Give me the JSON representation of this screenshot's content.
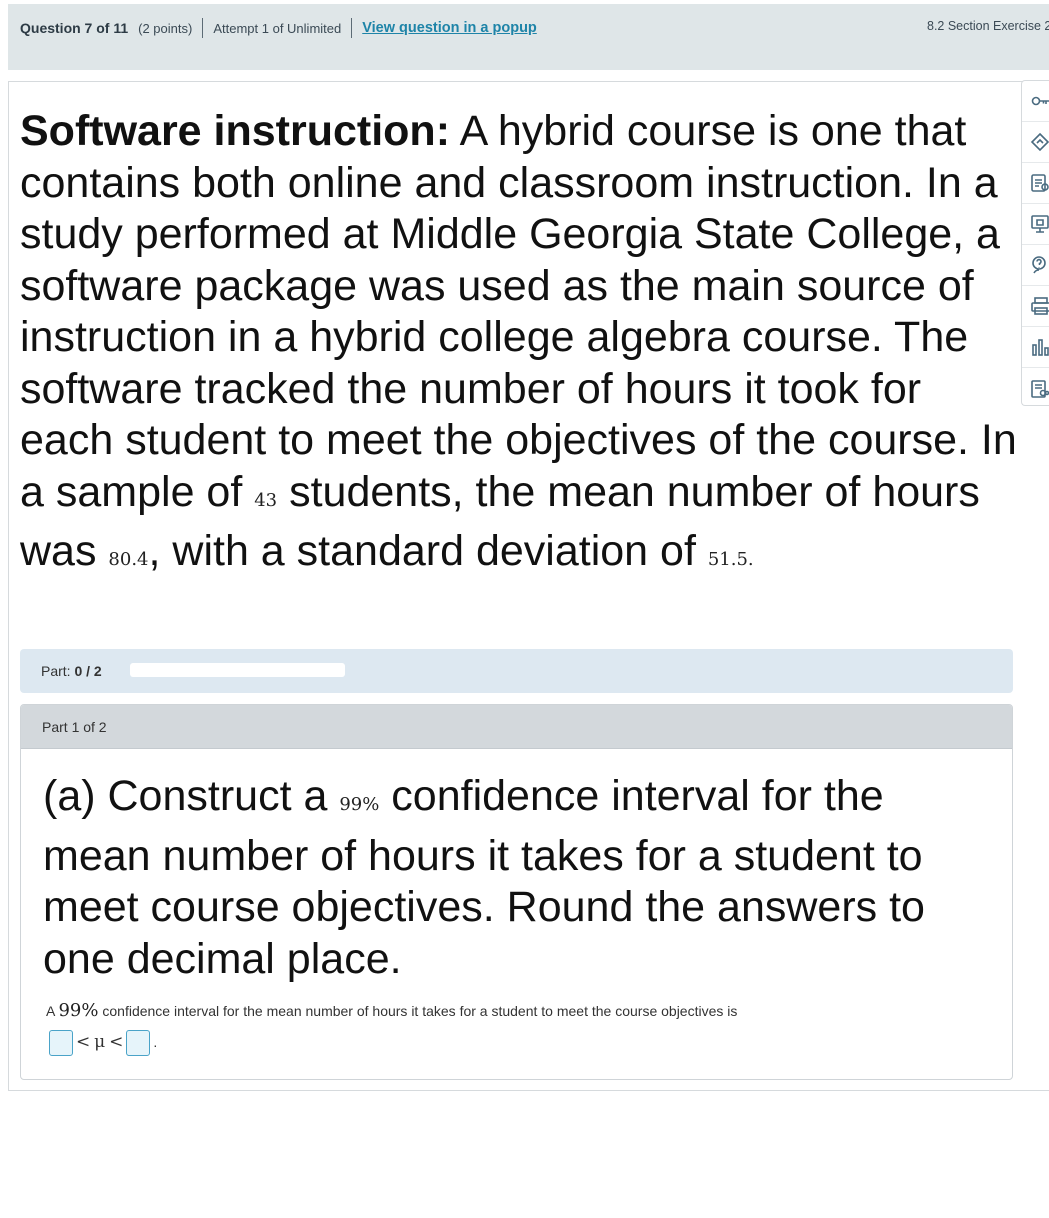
{
  "header": {
    "question_title": "Question 7 of 11",
    "points": "(2 points)",
    "attempt": "Attempt 1 of Unlimited",
    "popup_link": "View question in a popup",
    "section_label": "8.2 Section Exercise 2"
  },
  "question": {
    "lead": "Software instruction:",
    "text_1": " A hybrid course is one that contains both online and classroom instruction. In a study performed at Middle Georgia State College, a software package was used as the main source of instruction in a hybrid college algebra course. The software tracked the number of hours it took for each student to meet the objectives of the course. In a sample of ",
    "sample_size": "43",
    "text_2": " students, the mean number of hours was ",
    "mean": "80.4",
    "text_3": ", with a standard deviation of ",
    "std_dev": "51.5",
    "text_4": "."
  },
  "progress": {
    "label": "Part:",
    "value": "0 / 2",
    "fraction": 0
  },
  "part": {
    "header": "Part 1 of 2",
    "q_1": "(a) Construct a ",
    "confidence": "99%",
    "q_2": " confidence interval for the mean number of hours it takes for a student to meet course objectives. Round the answers to one decimal place.",
    "answer_1": "A ",
    "answer_conf": "99%",
    "answer_2": " confidence interval for the mean number of hours it takes for a student to meet the course objectives is ",
    "less_than_1": "<",
    "mu": "μ",
    "less_than_2": "<",
    "answer_end": "."
  },
  "tools": [
    {
      "icon": "key-icon"
    },
    {
      "icon": "hint-icon"
    },
    {
      "icon": "ebook-icon"
    },
    {
      "icon": "video-icon"
    },
    {
      "icon": "help-icon"
    },
    {
      "icon": "print-icon"
    },
    {
      "icon": "chart-icon"
    },
    {
      "icon": "data-icon"
    }
  ],
  "colors": {
    "header_bg": "#dfe6e8",
    "link": "#1e84a8",
    "progress_bg": "#dde8f1",
    "part_head_bg": "#d3d8dc",
    "answer_box_border": "#4aa3c8"
  }
}
